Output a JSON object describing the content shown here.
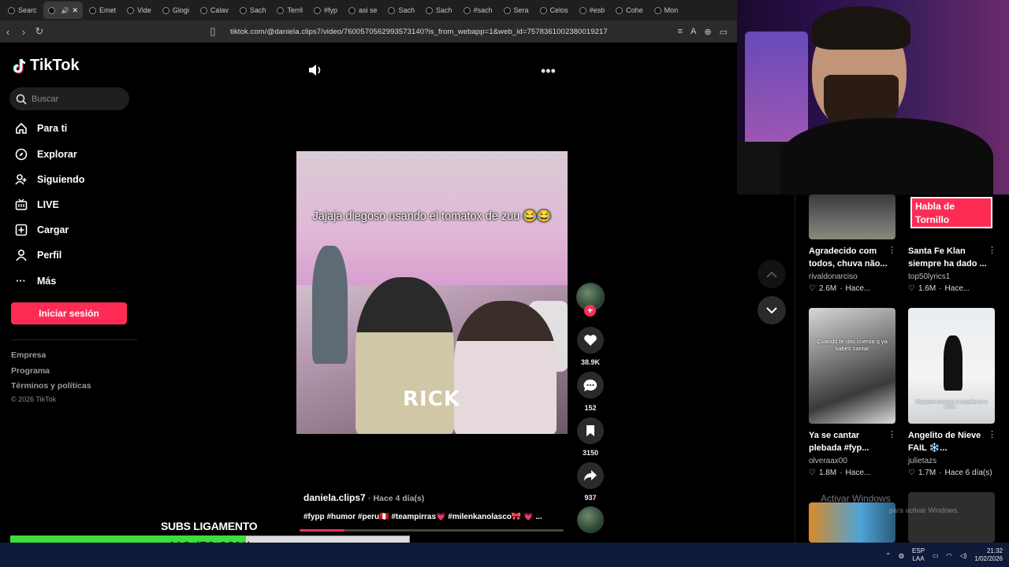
{
  "browser": {
    "tabs": [
      "Searc",
      "",
      "Emet",
      "Vide",
      "Glogi",
      "Calav",
      "Sach",
      "Terril",
      "#fyp",
      "asi se",
      "Sach",
      "Sach",
      "#sach",
      "Sera",
      "Celos",
      "#esb",
      "Cohe",
      "Mon"
    ],
    "url": "tiktok.com/@daniela.clips7/video/7600570562993573140?is_from_webapp=1&web_id=7578361002380019217"
  },
  "sidebar": {
    "brand": "TikTok",
    "search_placeholder": "Buscar",
    "nav": [
      "Para ti",
      "Explorar",
      "Siguiendo",
      "LIVE",
      "Cargar",
      "Perfil",
      "Más"
    ],
    "login_label": "Iniciar sesión",
    "footer": [
      "Empresa",
      "Programa",
      "Términos y políticas"
    ],
    "copyright": "© 2026 TikTok"
  },
  "video": {
    "caption": "Jajaja diegoso usando el tomatox de zuu 😂😂",
    "overlay_text": "RICK",
    "author": "daniela.clips7",
    "time": "· Hace 4 día(s)",
    "hashtags": "#fypp #humor #peru🇵🇪 #teampirras💗 #milenkanolasco🎀 💗 ...",
    "progress": 0.17
  },
  "actions": {
    "likes": "38.9K",
    "comments": "152",
    "saves": "3150",
    "shares": "937"
  },
  "recommendations": [
    {
      "title": "Agradecido com todos, chuva não...",
      "user": "rivaldonarciso",
      "likes": "2.6M",
      "time": "Hace..."
    },
    {
      "title": "Santa Fe Klan siempre ha dado ...",
      "user": "top50lyrics1",
      "likes": "1.6M",
      "time": "Hace...",
      "thumb_text": "Habla de Tornillo"
    },
    {
      "title": "Ya se cantar plebada #fyp...",
      "user": "olveraax00",
      "likes": "1.8M",
      "time": "Hace...",
      "thumb_text": "Cuando te das cuenta q ya sabes cantar"
    },
    {
      "title": "Angelito de Nieve FAIL ❄️...",
      "user": "julietazs",
      "likes": "1.7M",
      "time": "Hace 6 día(s)",
      "thumb_text": "Dibujando haciendo un angelito en la nieve..."
    }
  ],
  "stream": {
    "subs_label": "SUBS LIGAMENTO",
    "subs_text": "118 (59.00%)",
    "subs_fraction": 0.59
  },
  "watermark": {
    "title": "Activar Windows",
    "sub": "para activar Windows."
  },
  "taskbar": {
    "lang": "ESP",
    "lang2": "LAA",
    "time": "21:32",
    "date": "1/02/2026"
  },
  "colors": {
    "accent": "#fe2c55",
    "bar_fill": "#3cde3c"
  }
}
